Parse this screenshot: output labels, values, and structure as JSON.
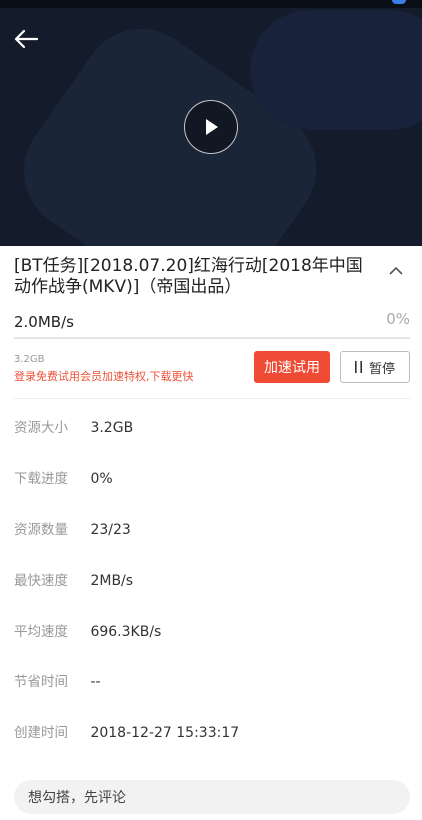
{
  "video": {
    "back_icon": "arrow-left-icon",
    "play_icon": "play-icon"
  },
  "task": {
    "title": "[BT任务][2018.07.20]红海行动[2018年中国动作战争(MKV)]（帝国出品）",
    "collapse_icon": "chevron-up-icon",
    "speed": "2.0MB/s",
    "percent": "0%",
    "progress": 0.0,
    "size": "3.2GB",
    "promo": "登录免费试用会员加速特权,下载更快",
    "accel_label": "加速试用",
    "pause_label": "暂停",
    "pause_icon": "pause-icon"
  },
  "info": [
    {
      "label": "资源大小",
      "value": "3.2GB"
    },
    {
      "label": "下载进度",
      "value": "0%"
    },
    {
      "label": "资源数量",
      "value": "23/23"
    },
    {
      "label": "最快速度",
      "value": "2MB/s"
    },
    {
      "label": "平均速度",
      "value": "696.3KB/s"
    },
    {
      "label": "节省时间",
      "value": "--"
    },
    {
      "label": "创建时间",
      "value": "2018-12-27 15:33:17"
    }
  ],
  "comment": {
    "placeholder": "想勾搭，先评论"
  },
  "colors": {
    "accent": "#ef4a33",
    "promo_text": "#ec5237",
    "video_bg": "#141c2b"
  }
}
